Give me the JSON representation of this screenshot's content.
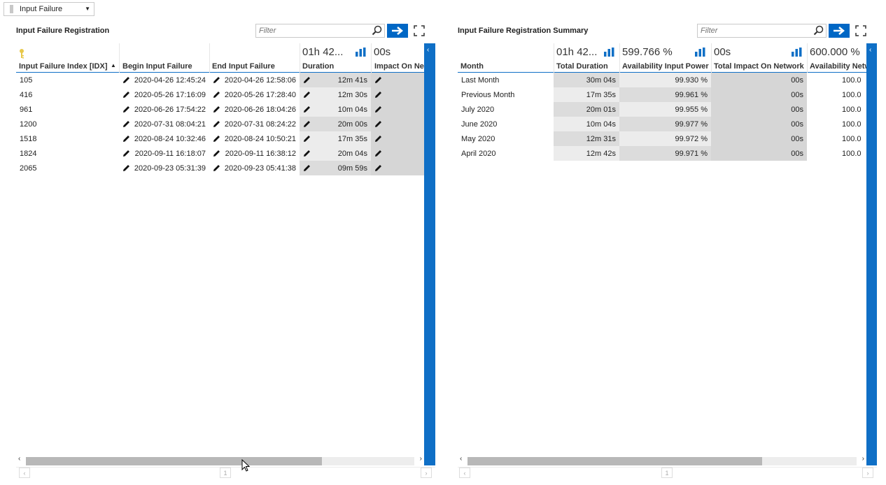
{
  "dropdown": {
    "value": "Input Failure"
  },
  "left": {
    "title": "Input Failure Registration",
    "filter_placeholder": "Filter",
    "agg_duration": "01h 42...",
    "agg_impact": "00s",
    "headers": [
      "Input Failure Index [IDX]",
      "Begin Input Failure",
      "End Input Failure",
      "Duration",
      "Impact On Netw"
    ],
    "rows": [
      {
        "idx": "105",
        "begin": "2020-04-26 12:45:24",
        "end": "2020-04-26 12:58:06",
        "duration": "12m 41s"
      },
      {
        "idx": "416",
        "begin": "2020-05-26 17:16:09",
        "end": "2020-05-26 17:28:40",
        "duration": "12m 30s"
      },
      {
        "idx": "961",
        "begin": "2020-06-26 17:54:22",
        "end": "2020-06-26 18:04:26",
        "duration": "10m 04s"
      },
      {
        "idx": "1200",
        "begin": "2020-07-31 08:04:21",
        "end": "2020-07-31 08:24:22",
        "duration": "20m 00s"
      },
      {
        "idx": "1518",
        "begin": "2020-08-24 10:32:46",
        "end": "2020-08-24 10:50:21",
        "duration": "17m 35s"
      },
      {
        "idx": "1824",
        "begin": "2020-09-11 16:18:07",
        "end": "2020-09-11 16:38:12",
        "duration": "20m 04s"
      },
      {
        "idx": "2065",
        "begin": "2020-09-23 05:31:39",
        "end": "2020-09-23 05:41:38",
        "duration": "09m 59s"
      }
    ],
    "page": "1"
  },
  "right": {
    "title": "Input Failure Registration Summary",
    "filter_placeholder": "Filter",
    "agg_total_duration": "01h 42...",
    "agg_availability": "599.766 %",
    "agg_total_impact": "00s",
    "agg_availability_network": "600.000 %",
    "headers": [
      "Month",
      "Total Duration",
      "Availability Input Power",
      "Total Impact On Network",
      "Availability Netw"
    ],
    "rows": [
      {
        "month": "Last Month",
        "total_duration": "30m 04s",
        "availability": "99.930 %",
        "impact": "00s",
        "avail_net": "100.0"
      },
      {
        "month": "Previous Month",
        "total_duration": "17m 35s",
        "availability": "99.961 %",
        "impact": "00s",
        "avail_net": "100.0"
      },
      {
        "month": "July 2020",
        "total_duration": "20m 01s",
        "availability": "99.955 %",
        "impact": "00s",
        "avail_net": "100.0"
      },
      {
        "month": "June 2020",
        "total_duration": "10m 04s",
        "availability": "99.977 %",
        "impact": "00s",
        "avail_net": "100.0"
      },
      {
        "month": "May 2020",
        "total_duration": "12m 31s",
        "availability": "99.972 %",
        "impact": "00s",
        "avail_net": "100.0"
      },
      {
        "month": "April 2020",
        "total_duration": "12m 42s",
        "availability": "99.971 %",
        "impact": "00s",
        "avail_net": "100.0"
      }
    ],
    "page": "1"
  },
  "colors": {
    "accent": "#0f6fc6",
    "button": "#0067c5",
    "key_icon": "#e8c84a"
  },
  "icons": [
    "chevron-down-icon",
    "search-icon",
    "arrow-right-icon",
    "expand-icon",
    "key-icon",
    "sort-asc-icon",
    "pencil-icon",
    "bar-chart-icon",
    "chevron-left-icon",
    "chevron-right-icon"
  ]
}
